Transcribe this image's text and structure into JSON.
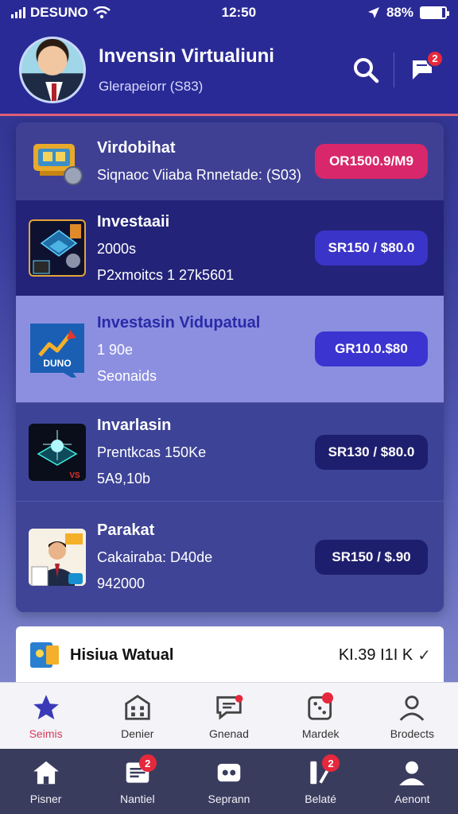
{
  "status_bar": {
    "carrier": "DESUNO",
    "time": "12:50",
    "battery": "88%",
    "battery_level": 0.88
  },
  "header": {
    "title": "Invensin Virtualiuni",
    "subtitle": "Glerapeiorr (S83)",
    "notification_count": "2"
  },
  "investments": [
    {
      "name": "Virdobihat",
      "line2": "Siqnaoc Viiaba Rnnetade: (S03)",
      "line3": "",
      "price": "OR1500.9/M9",
      "price_color": "#d8276a"
    },
    {
      "name": "Investaaii",
      "line2": "2000s",
      "line3": "P2xmoitcs 1 27k5601",
      "price": "SR150 / $80.0",
      "price_color": "#3b34c8"
    },
    {
      "name": "Investasin Vidupatual",
      "line2": "1 90e",
      "line3": "Seonaids",
      "price": "GR10.0.$80",
      "price_color": "#3b34d0"
    },
    {
      "name": "Invarlasin",
      "line2": "Prentkcas 150Ke",
      "line3": "5A9,10b",
      "price": "SR130 / $80.0",
      "price_color": "#1e1e6e"
    },
    {
      "name": "Parakat",
      "line2": "Cakairaba: D40de",
      "line3": "942000",
      "price": "SR150 / $.90",
      "price_color": "#1e1e6e"
    }
  ],
  "wallet": {
    "title": "Hisiua Watual",
    "amount": "KI.39 I1I K",
    "check": "✓"
  },
  "secondary_tabs": [
    {
      "label": "Seimis",
      "icon": "star-icon",
      "active": true
    },
    {
      "label": "Denier",
      "icon": "building-icon",
      "active": false
    },
    {
      "label": "Gnenad",
      "icon": "chat-icon",
      "active": false
    },
    {
      "label": "Mardek",
      "icon": "dice-icon",
      "active": false
    },
    {
      "label": "Brodects",
      "icon": "person-icon",
      "active": false
    }
  ],
  "bottom_nav": [
    {
      "label": "Pisner",
      "icon": "home-icon",
      "badge": ""
    },
    {
      "label": "Nantiel",
      "icon": "news-icon",
      "badge": "2"
    },
    {
      "label": "Seprann",
      "icon": "game-icon",
      "badge": ""
    },
    {
      "label": "Belaté",
      "icon": "tools-icon",
      "badge": "2"
    },
    {
      "label": "Aenont",
      "icon": "account-icon",
      "badge": ""
    }
  ],
  "colors": {
    "header_bg": "#2a2a96",
    "accent_pink": "#d8276a",
    "accent_blue": "#3b34c8",
    "active_tab": "#d63a5a"
  }
}
